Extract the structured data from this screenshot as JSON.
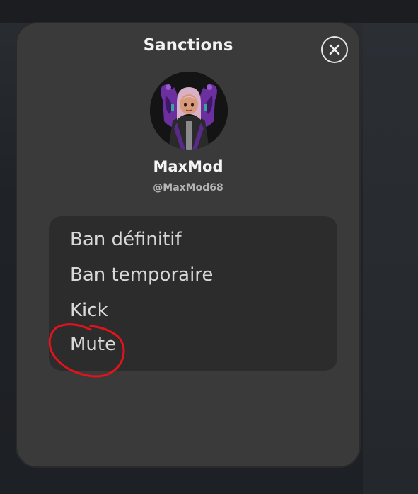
{
  "modal": {
    "title": "Sanctions",
    "close_icon": "close-icon"
  },
  "profile": {
    "display_name": "MaxMod",
    "handle": "@MaxMod68",
    "avatar_icon": "avatar"
  },
  "sanctions_menu": {
    "items": [
      {
        "label": "Ban définitif"
      },
      {
        "label": "Ban temporaire"
      },
      {
        "label": "Kick"
      },
      {
        "label": "Mute"
      }
    ],
    "highlighted": "Mute",
    "highlight_color": "#e0141c"
  },
  "colors": {
    "modal_bg": "#3a3a3a",
    "menu_bg": "#2c2c2c",
    "text": "#d8d8d8",
    "annotation": "#e0141c"
  }
}
